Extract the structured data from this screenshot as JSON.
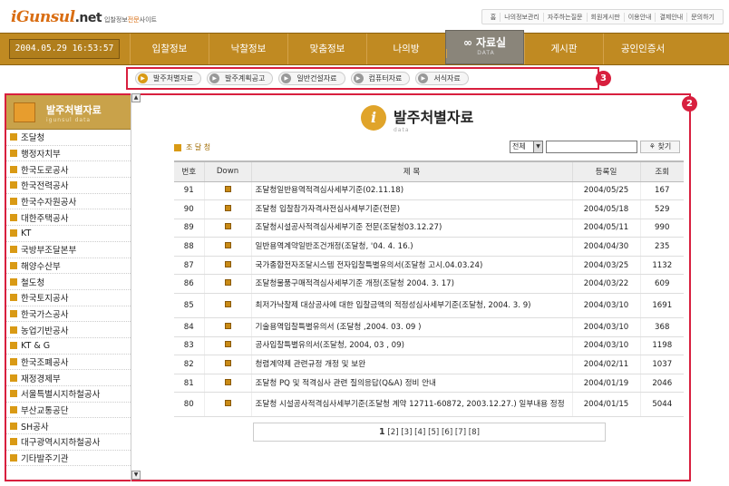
{
  "site": {
    "logo_main": "iGunsul",
    "logo_dot": ".net",
    "tagline_a": "입찰정보",
    "tagline_b": "전문",
    "tagline_c": "사이트",
    "top_links": [
      "홈",
      "나의정보관리",
      "자주하는질문",
      "회원게시판",
      "이용안내",
      "결제안내",
      "문의하기"
    ]
  },
  "datetime": "2004.05.29 16:53:57",
  "nav": {
    "items": [
      "입찰정보",
      "낙찰정보",
      "맞춤정보",
      "나의방",
      "자료실",
      "게시판",
      "공인인증서"
    ],
    "active_sub": "DATA"
  },
  "subtabs": [
    "발주처별자료",
    "발주계획공고",
    "일반건설자료",
    "컴퓨터자료",
    "서식자료"
  ],
  "callouts": {
    "subbar": "3",
    "content": "2"
  },
  "sidebar": {
    "title": "발주처별자료",
    "subtitle": "igunsul data",
    "items": [
      "조달청",
      "행정자치부",
      "한국도로공사",
      "한국전력공사",
      "한국수자원공사",
      "대한주택공사",
      "KT",
      "국방부조달본부",
      "해양수산부",
      "철도청",
      "한국토지공사",
      "한국가스공사",
      "농업기반공사",
      "KT & G",
      "한국조폐공사",
      "재정경제부",
      "서울특별시지하철공사",
      "부산교통공단",
      "SH공사",
      "대구광역시지하철공사",
      "기타발주기관"
    ]
  },
  "content": {
    "title": "발주처별자료",
    "title_en": "data",
    "breadcrumb": "조 달 청",
    "search": {
      "select": "전체",
      "button": "찾기"
    },
    "columns": [
      "번호",
      "Down",
      "제 목",
      "등록일",
      "조회"
    ],
    "rows": [
      {
        "no": "91",
        "title": "조달청일반용역적격심사세부기준(02.11.18)",
        "date": "2004/05/25",
        "views": "167"
      },
      {
        "no": "90",
        "title": "조달청 입찰참가자격사전심사세부기준(전문)",
        "date": "2004/05/18",
        "views": "529"
      },
      {
        "no": "89",
        "title": "조달청시설공사적격심사세부기준 전문(조달청03.12.27)",
        "date": "2004/05/11",
        "views": "990"
      },
      {
        "no": "88",
        "title": "일반용역계약일반조건개정(조달청, '04. 4. 16.)",
        "date": "2004/04/30",
        "views": "235"
      },
      {
        "no": "87",
        "title": "국가종합전자조달시스템 전자입찰특별유의서(조달청 고시.04.03.24)",
        "date": "2004/03/25",
        "views": "1132"
      },
      {
        "no": "86",
        "title": "조달청물품구매적격심사세부기준 개정(조달청 2004. 3. 17)",
        "date": "2004/03/22",
        "views": "609"
      },
      {
        "no": "85",
        "title": "최저가낙찰제 대상공사에 대한 입찰금액의 적정성심사세부기준(조달청, 2004. 3. 9)",
        "date": "2004/03/10",
        "views": "1691"
      },
      {
        "no": "84",
        "title": "기술용역입찰특별유의서 (조달청 ,2004. 03. 09 )",
        "date": "2004/03/10",
        "views": "368"
      },
      {
        "no": "83",
        "title": "공사입찰특별유의서(조달청, 2004, 03 , 09)",
        "date": "2004/03/10",
        "views": "1198"
      },
      {
        "no": "82",
        "title": "청렴계약제 관련규정 개정 및 보완",
        "date": "2004/02/11",
        "views": "1037"
      },
      {
        "no": "81",
        "title": "조달청 PQ 및 적격심사 관련 질의응답(Q&A) 정비 안내",
        "date": "2004/01/19",
        "views": "2046"
      },
      {
        "no": "80",
        "title": "조달청 시설공사적격심사세부기준(조달청 계약 12711-60872, 2003.12.27.) 일부내용 정정",
        "date": "2004/01/15",
        "views": "5044"
      }
    ],
    "pager": {
      "current": "1",
      "others": "[2] [3] [4] [5] [6] [7] [8]"
    }
  }
}
